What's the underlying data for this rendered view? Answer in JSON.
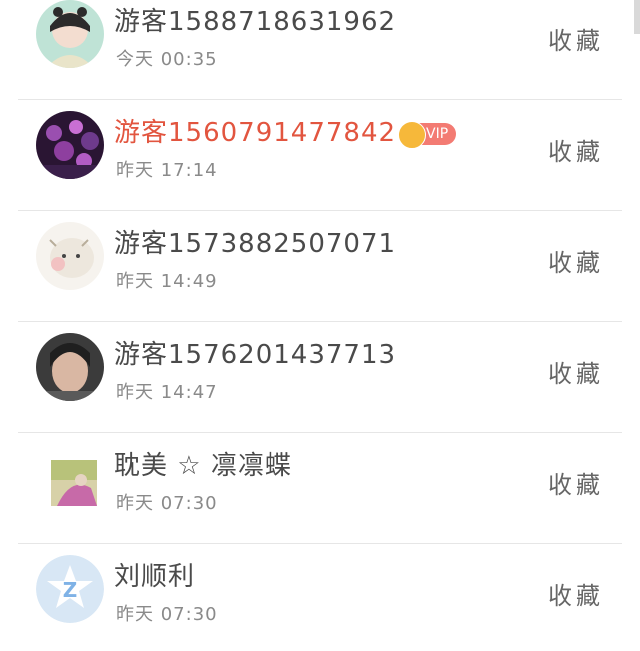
{
  "list": {
    "collect_label": "收藏",
    "rows": [
      {
        "name": "游客15887186319​62",
        "time": "今天 00:35"
      },
      {
        "name": "游客15607914778​42",
        "time": "昨天 17:14",
        "vip": "VIP"
      },
      {
        "name": "游客15738825070​71",
        "time": "昨天 14:49"
      },
      {
        "name": "游客15762014377​13",
        "time": "昨天 14:47"
      },
      {
        "name": "耽美 ☆ 凛凛蝶",
        "time": "昨天 07:30"
      },
      {
        "name": "刘顺利",
        "time": "昨天 07:30"
      }
    ]
  },
  "colors": {
    "vip_name": "#e2553f",
    "normal_name": "#4a4a4a",
    "time": "#8a8a8a",
    "vip_badge": "#f37b73",
    "crown": "#f6b83a"
  }
}
